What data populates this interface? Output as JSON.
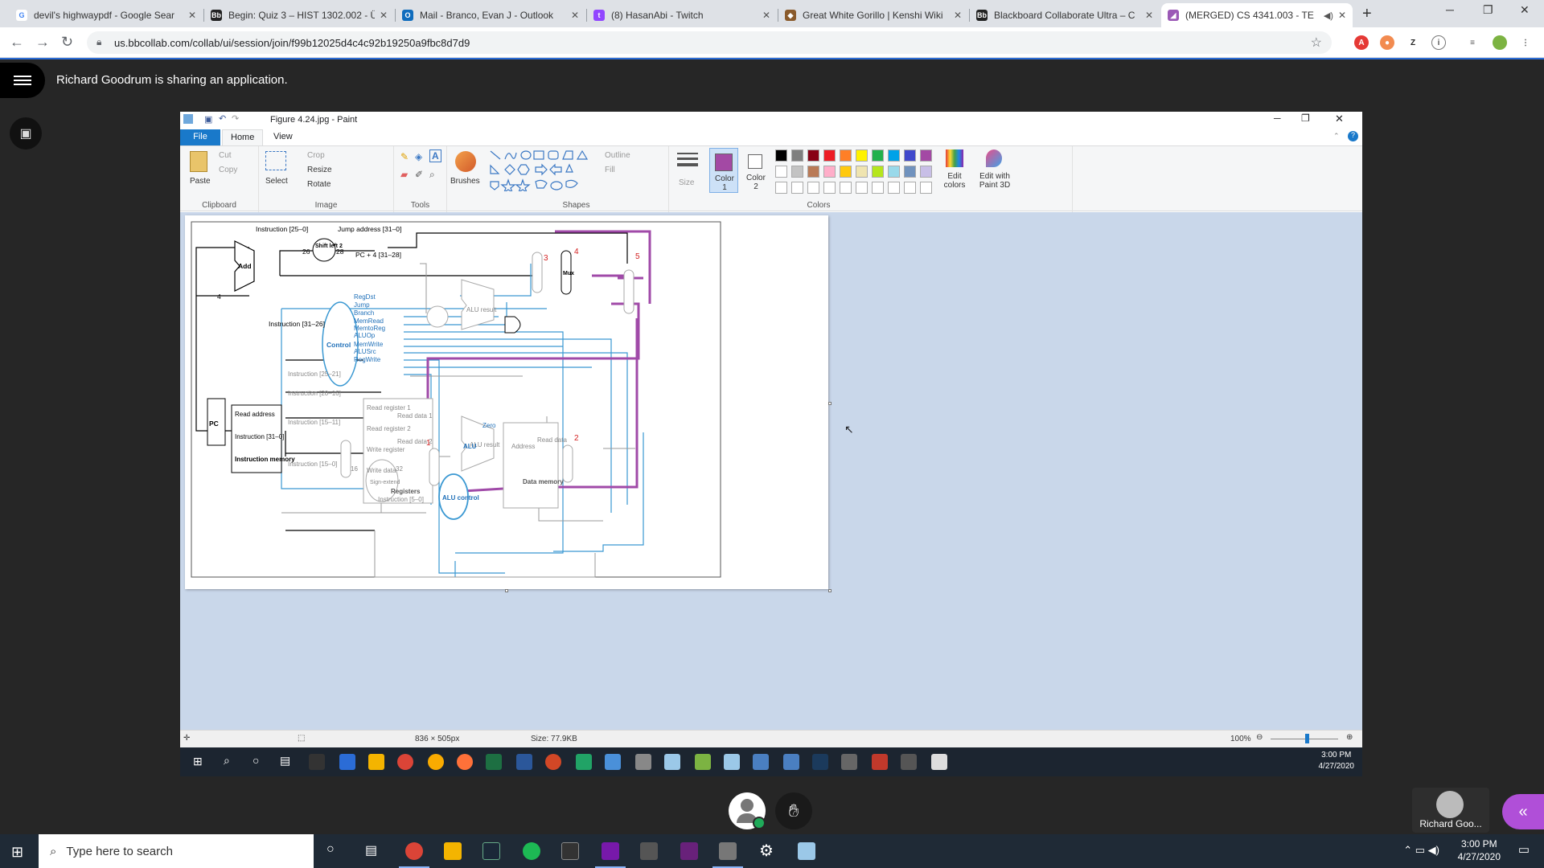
{
  "browser": {
    "tabs": [
      {
        "title": "devil's highwaypdf - Google Sear",
        "icon": "google-icon",
        "color": "#4285f4"
      },
      {
        "title": "Begin: Quiz 3 – HIST 1302.002 - Ü",
        "icon": "blackboard-icon",
        "color": "#222222"
      },
      {
        "title": "Mail - Branco, Evan J - Outlook",
        "icon": "outlook-icon",
        "color": "#0f6cbd"
      },
      {
        "title": "(8) HasanAbi - Twitch",
        "icon": "twitch-icon",
        "color": "#9146ff"
      },
      {
        "title": "Great White Gorillo | Kenshi Wiki",
        "icon": "fandom-icon",
        "color": "#8a5a2b"
      },
      {
        "title": "Blackboard Collaborate Ultra – C",
        "icon": "blackboard-icon",
        "color": "#222222"
      },
      {
        "title": "(MERGED) CS 4341.003 - TE",
        "icon": "collab-icon",
        "color": "#9b59b6"
      }
    ],
    "url": "us.bbcollab.com/collab/ui/session/join/f99b12025d4c4c92b19250a9fbc8d7d9"
  },
  "collab": {
    "share_message": "Richard Goodrum is sharing an application.",
    "presenter_name": "Richard Goo..."
  },
  "paint": {
    "window_title": "Figure 4.24.jpg - Paint",
    "ribbon_tabs": [
      "File",
      "Home",
      "View"
    ],
    "clipboard": {
      "paste": "Paste",
      "cut": "Cut",
      "copy": "Copy",
      "label": "Clipboard"
    },
    "image": {
      "select": "Select",
      "crop": "Crop",
      "resize": "Resize",
      "rotate": "Rotate",
      "label": "Image"
    },
    "tools_label": "Tools",
    "brushes": "Brushes",
    "shapes": {
      "outline": "Outline",
      "fill": "Fill",
      "label": "Shapes"
    },
    "size": "Size",
    "color1": "Color 1",
    "color2": "Color 2",
    "colors_label": "Colors",
    "edit_colors": "Edit colors",
    "edit_paint3d": "Edit with Paint 3D",
    "palette_row1": [
      "#000000",
      "#7f7f7f",
      "#880015",
      "#ed1c24",
      "#ff7f27",
      "#fff200",
      "#22b14c",
      "#00a2e8",
      "#3f48cc",
      "#a349a4"
    ],
    "palette_row2": [
      "#ffffff",
      "#c3c3c3",
      "#b97a57",
      "#ffaec9",
      "#ffc90e",
      "#efe4b0",
      "#b5e61d",
      "#99d9ea",
      "#7092be",
      "#c8bfe7"
    ],
    "status_dimensions": "836 × 505px",
    "status_size": "Size: 77.9KB",
    "zoom": "100%"
  },
  "diagram": {
    "labels": {
      "instr_25_0": "Instruction [25–0]",
      "jump_addr": "Jump address [31–0]",
      "shift_left2": "Shift left 2",
      "pc4": "PC + 4 [31–28]",
      "add": "Add",
      "four": "4",
      "n26": "26",
      "n28": "28",
      "instr_31_26": "Instruction [31–26]",
      "control": "Control",
      "ctrl_signals": [
        "RegDst",
        "Jump",
        "Branch",
        "MemRead",
        "MemtoReg",
        "ALUOp",
        "MemWrite",
        "ALUSrc",
        "RegWrite"
      ],
      "pc": "PC",
      "read_address": "Read address",
      "instruction": "Instruction [31–0]",
      "instr_memory": "Instruction memory",
      "instr_25_21": "Instruction [25–21]",
      "instr_20_16": "Instruction [20–16]",
      "instr_15_11": "Instruction [15–11]",
      "instr_15_0": "Instruction [15–0]",
      "instr_5_0": "Instruction [5–0]",
      "registers": "Registers",
      "read_reg1": "Read register 1",
      "read_reg2": "Read register 2",
      "write_reg": "Write register",
      "write_data": "Write data",
      "read_data1": "Read data 1",
      "read_data2": "Read data 2",
      "sign_extend": "Sign-extend",
      "n16": "16",
      "n32": "32",
      "alu_control": "ALU control",
      "alu": "ALU",
      "zero": "Zero",
      "alu_result": "ALU result",
      "address": "Address",
      "read_data": "Read data",
      "data_memory": "Data memory",
      "mux": "Mux",
      "ann": [
        "1",
        "2",
        "3",
        "4",
        "5"
      ]
    }
  },
  "remote": {
    "time": "3:00 PM",
    "date": "4/27/2020"
  },
  "taskbar": {
    "search_placeholder": "Type here to search",
    "time": "3:00 PM",
    "date": "4/27/2020"
  }
}
